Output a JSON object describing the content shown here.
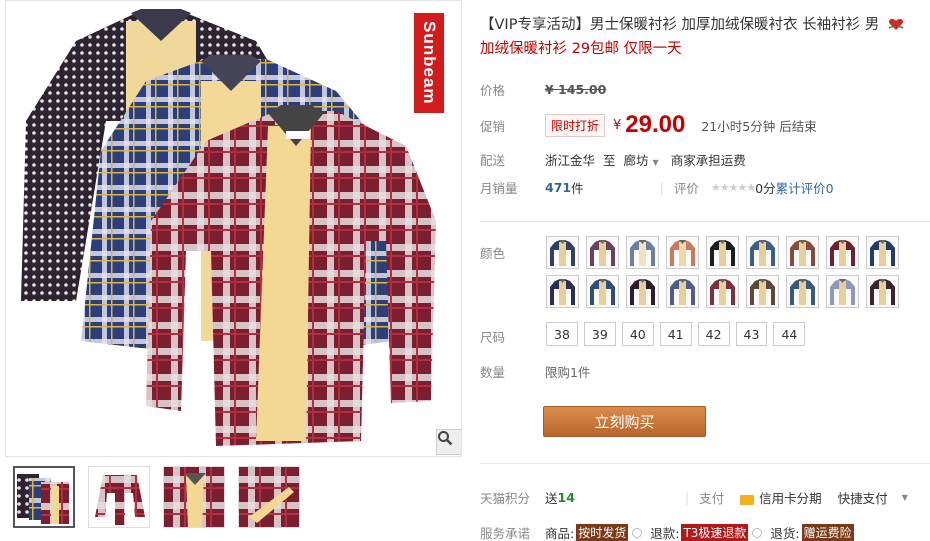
{
  "product": {
    "brand_tag": "Sunbeam",
    "title": "【VIP专享活动】男士保暖衬衫 加厚加绒保暖衬衣 长袖衬衫 男",
    "subtitle": "加绒保暖衬衫 29包邮 仅限一天"
  },
  "price": {
    "label": "价格",
    "original": "¥ 145.00"
  },
  "promo": {
    "label": "促销",
    "tag": "限时打折",
    "currency": "¥",
    "price": "29.00",
    "countdown": "21小时5分钟 后结束"
  },
  "delivery": {
    "label": "配送",
    "from": "浙江金华",
    "to_word": "至",
    "to": "廊坊",
    "fee": "商家承担运费"
  },
  "sales": {
    "label": "月销量",
    "count": "471",
    "unit": "件",
    "review_label": "评价",
    "rating": "0分",
    "review_text": "累计评价0"
  },
  "color": {
    "label": "颜色",
    "swatches": [
      {
        "name": "color-1",
        "color": "#2f3f66",
        "lining": "#e6cf9a"
      },
      {
        "name": "color-2",
        "color": "#6a4060",
        "lining": "#e6cf9a"
      },
      {
        "name": "color-3",
        "color": "#6a7ea8",
        "lining": "#efe2c0"
      },
      {
        "name": "color-4",
        "color": "#c97a5c",
        "lining": "#f0d7a6"
      },
      {
        "name": "color-5",
        "color": "#1c1c24",
        "lining": "#e6cf9a"
      },
      {
        "name": "color-6",
        "color": "#3b5e88",
        "lining": "#e6cf9a"
      },
      {
        "name": "color-7",
        "color": "#8a4a3a",
        "lining": "#e6cf9a"
      },
      {
        "name": "color-8",
        "color": "#6e2033",
        "lining": "#e6cf9a"
      },
      {
        "name": "color-9",
        "color": "#233a6e",
        "lining": "#e6cf9a"
      },
      {
        "name": "color-10",
        "color": "#2a2f52",
        "lining": "#e6cf9a"
      },
      {
        "name": "color-11",
        "color": "#2d4f7a",
        "lining": "#e6cf9a"
      },
      {
        "name": "color-12",
        "color": "#2a1e2a",
        "lining": "#e6cf9a"
      },
      {
        "name": "color-13",
        "color": "#4d5e88",
        "lining": "#e6cf9a"
      },
      {
        "name": "color-14",
        "color": "#7a3040",
        "lining": "#e6cf9a"
      },
      {
        "name": "color-15",
        "color": "#5a4a3a",
        "lining": "#e6cf9a"
      },
      {
        "name": "color-16",
        "color": "#3a5a7a",
        "lining": "#e6cf9a"
      },
      {
        "name": "color-17",
        "color": "#8a9ab8",
        "lining": "#e6cf9a"
      },
      {
        "name": "color-18",
        "color": "#3a2430",
        "lining": "#e6cf9a"
      }
    ]
  },
  "size": {
    "label": "尺码",
    "options": [
      "38",
      "39",
      "40",
      "41",
      "42",
      "43",
      "44"
    ]
  },
  "quantity": {
    "label": "数量",
    "limit": "限购1件"
  },
  "buy_button": "立刻购买",
  "points": {
    "label": "天猫积分",
    "send": "送",
    "value": "14",
    "pay_label": "支付",
    "credit": "信用卡分期",
    "fast_pay": "快捷支付"
  },
  "service": {
    "label": "服务承诺",
    "goods": "商品:",
    "goods_tag": "按时发货",
    "refund": "退款:",
    "refund_tag": "T3极速退款",
    "return": "退货:",
    "return_tag": "赠运费险"
  },
  "colors": {
    "accent_red": "#c40000",
    "buy_orange": "#c8753a",
    "link_blue": "#336699"
  }
}
